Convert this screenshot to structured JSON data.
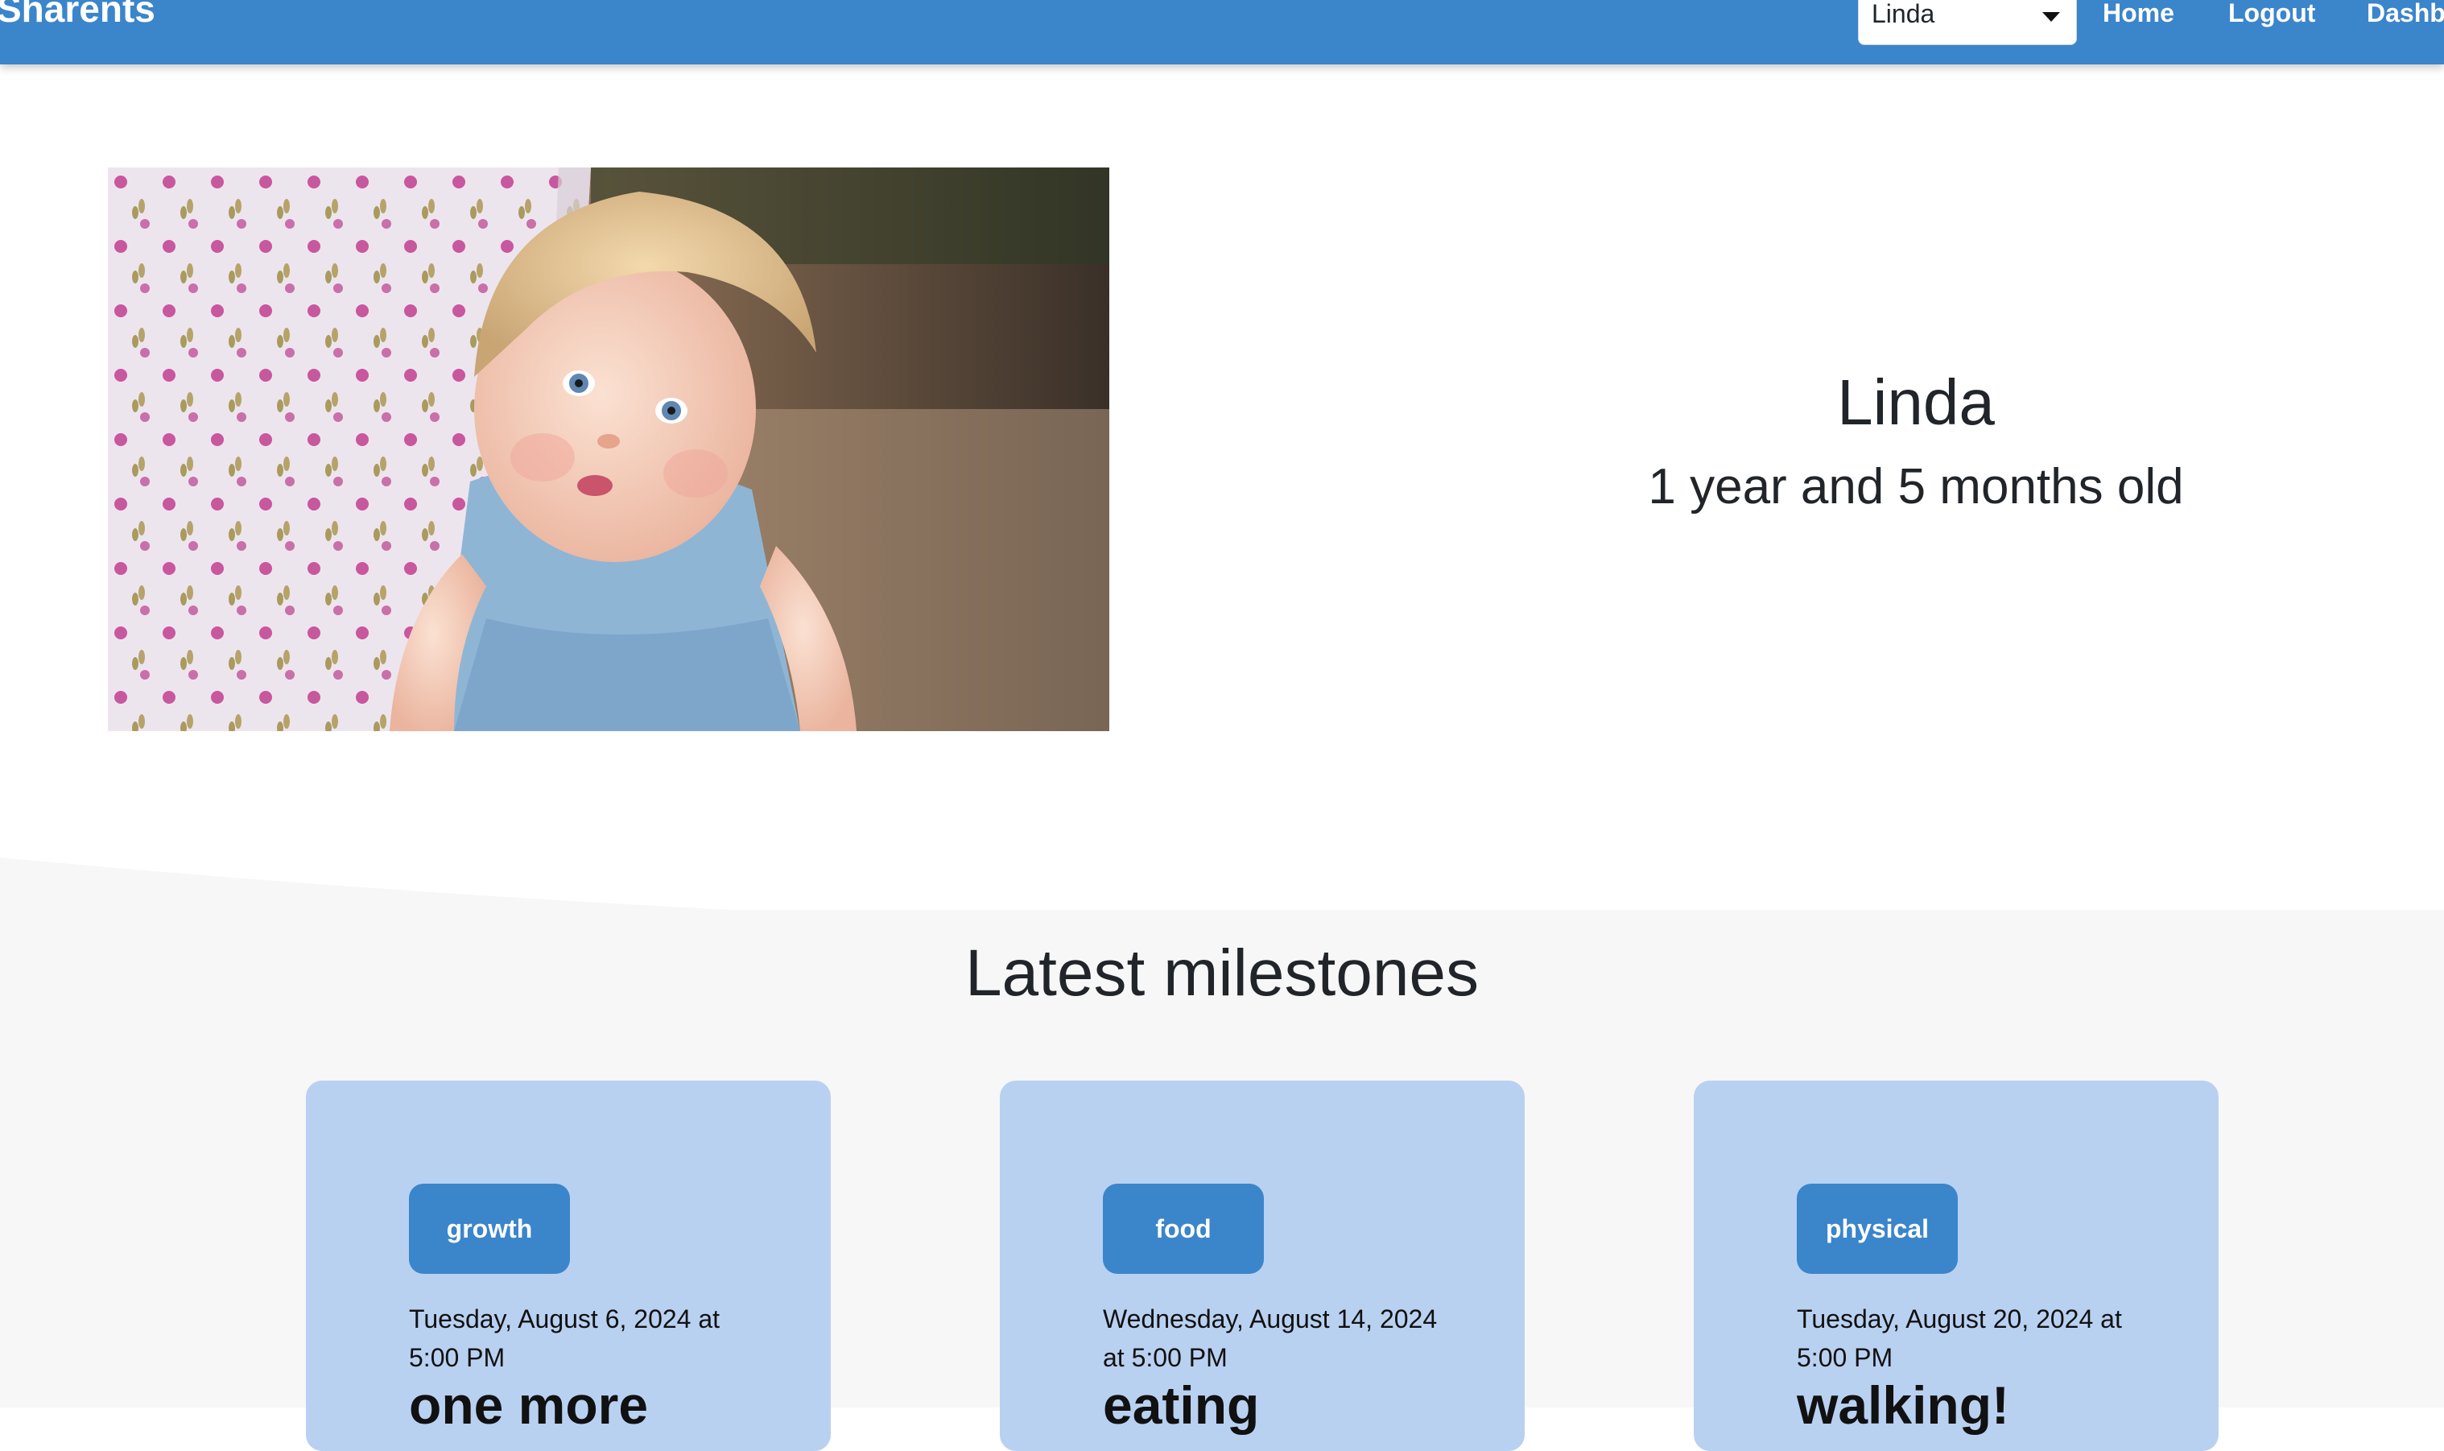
{
  "app": {
    "brand": "Sharents"
  },
  "nav": {
    "child_selector_value": "Linda",
    "home_label": "Home",
    "logout_label": "Logout",
    "dashboard_label": "Dashb"
  },
  "profile": {
    "name": "Linda",
    "age": "1 year and 5 months old",
    "photo_icon": "baby-photo"
  },
  "milestones": {
    "title": "Latest milestones",
    "items": [
      {
        "category": "growth",
        "date": "Tuesday, August 6, 2024 at 5:00 PM",
        "title": "one more"
      },
      {
        "category": "food",
        "date": "Wednesday, August 14, 2024 at 5:00 PM",
        "title": "eating"
      },
      {
        "category": "physical",
        "date": "Tuesday, August 20, 2024 at 5:00 PM",
        "title": "walking!"
      }
    ]
  },
  "colors": {
    "primary": "#3b85cb",
    "card_background": "#b9d1f1",
    "section_background": "#f7f7f7",
    "text": "#212529"
  }
}
